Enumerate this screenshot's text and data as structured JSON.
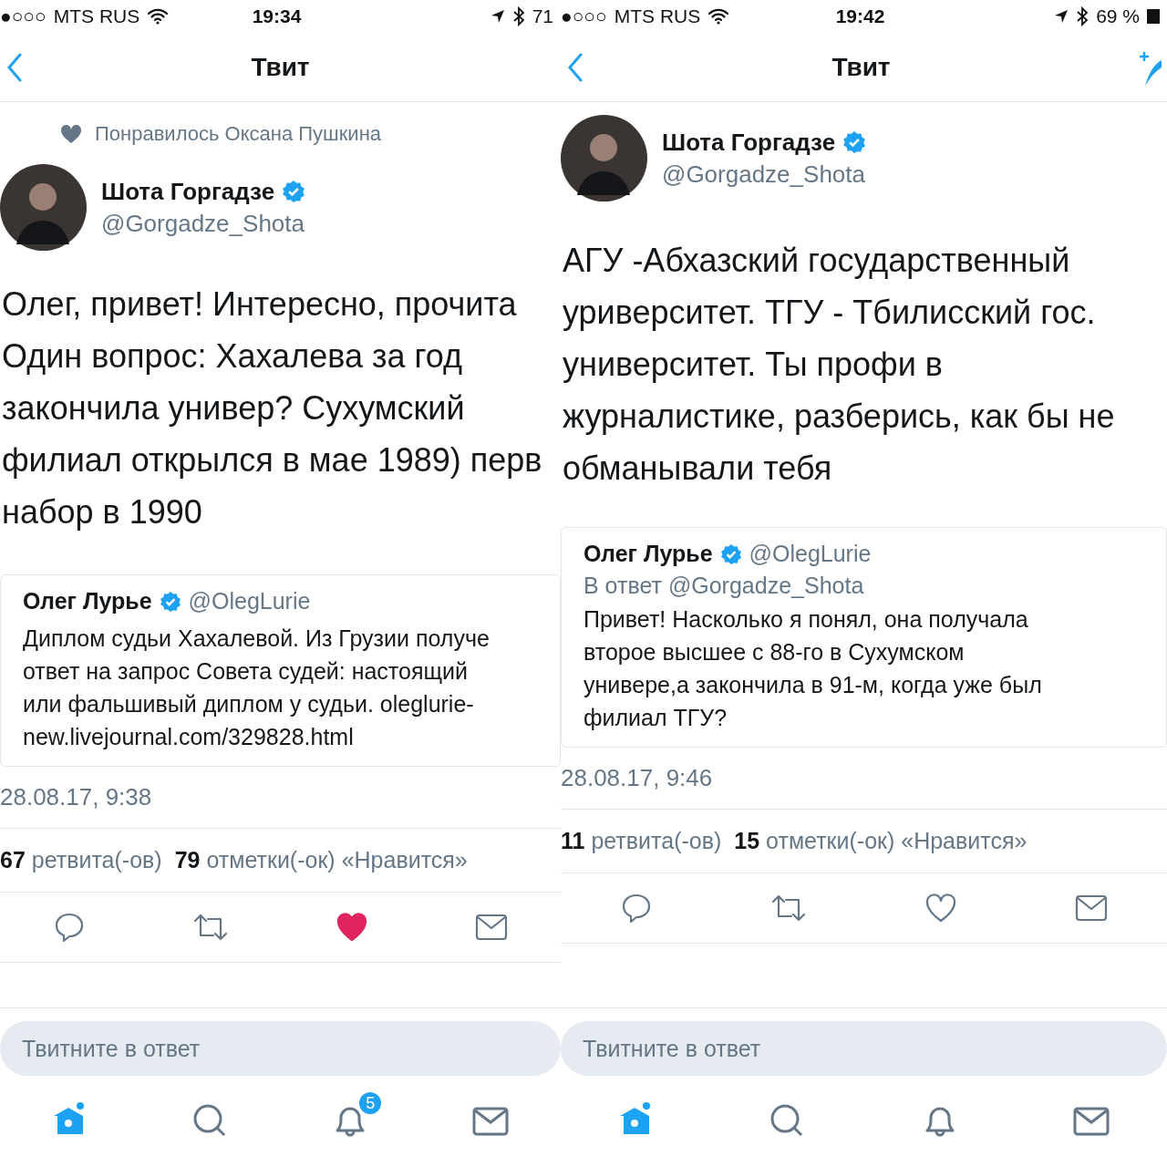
{
  "screens": [
    {
      "status_bar": {
        "signal": "●○○○",
        "carrier": "MTS RUS",
        "time": "19:34",
        "battery": "71",
        "battery_icon": false
      },
      "nav": {
        "title": "Твит",
        "compose_button": false
      },
      "liked_by": "Понравилось Оксана Пушкина",
      "author": {
        "name": "Шота Горгадзе",
        "verified": true,
        "handle": "@Gorgadze_Shota"
      },
      "text_lines": [
        "Олег, привет! Интересно, прочита",
        "Один вопрос: Хахалева за год",
        "закончила универ? Сухумский",
        "филиал открылся в мае 1989) перв",
        "набор в 1990"
      ],
      "quote": {
        "name": "Олег Лурье",
        "verified": true,
        "handle": "@OlegLurie",
        "text_lines": [
          "Диплом судьи Хахалевой. Из Грузии получе",
          "ответ на запрос Совета судей: настоящий",
          "или фальшивый диплом у судьи.  oleglurie-",
          "new.livejournal.com/329828.html"
        ]
      },
      "timestamp": "28.08.17, 9:38",
      "stats": [
        {
          "count": "67",
          "label": "ретвита(-ов)"
        },
        {
          "count": "79",
          "label": "отметки(-ок) «Нравится»"
        }
      ],
      "liked": true,
      "reply_placeholder": "Твитните в ответ",
      "tabs": [
        {
          "kind": "home",
          "selected": true
        },
        {
          "kind": "search",
          "selected": false
        },
        {
          "kind": "notifications",
          "selected": false,
          "badge": "5"
        },
        {
          "kind": "messages",
          "selected": false
        }
      ]
    },
    {
      "status_bar": {
        "signal": "●○○○",
        "carrier": "MTS RUS",
        "time": "19:42",
        "battery": "69 %",
        "battery_icon": true
      },
      "nav": {
        "title": "Твит",
        "compose_button": true
      },
      "author": {
        "name": "Шота Горгадзе",
        "verified": true,
        "handle": "@Gorgadze_Shota"
      },
      "text_lines": [
        "АГУ -Абхазский государственный",
        "уриверситет. ТГУ - Тбилисский гос.",
        "университет. Ты профи в",
        "журналистике, разберись, как бы не",
        "обманывали тебя"
      ],
      "quote": {
        "name": "Олег Лурье",
        "verified": true,
        "handle": "@OlegLurie",
        "reply_to": "В ответ @Gorgadze_Shota",
        "text_lines": [
          "Привет! Насколько я понял, она получала",
          "второе высшее с 88-го в Сухумском",
          "универе,а закончила в 91-м, когда уже был",
          "филиал ТГУ?"
        ]
      },
      "timestamp": "28.08.17, 9:46",
      "stats": [
        {
          "count": "11",
          "label": "ретвита(-ов)"
        },
        {
          "count": "15",
          "label": "отметки(-ок) «Нравится»"
        }
      ],
      "liked": false,
      "reply_placeholder": "Твитните в ответ",
      "tabs": [
        {
          "kind": "home",
          "selected": true
        },
        {
          "kind": "search",
          "selected": false
        },
        {
          "kind": "notifications",
          "selected": false
        },
        {
          "kind": "messages",
          "selected": false
        }
      ]
    }
  ]
}
